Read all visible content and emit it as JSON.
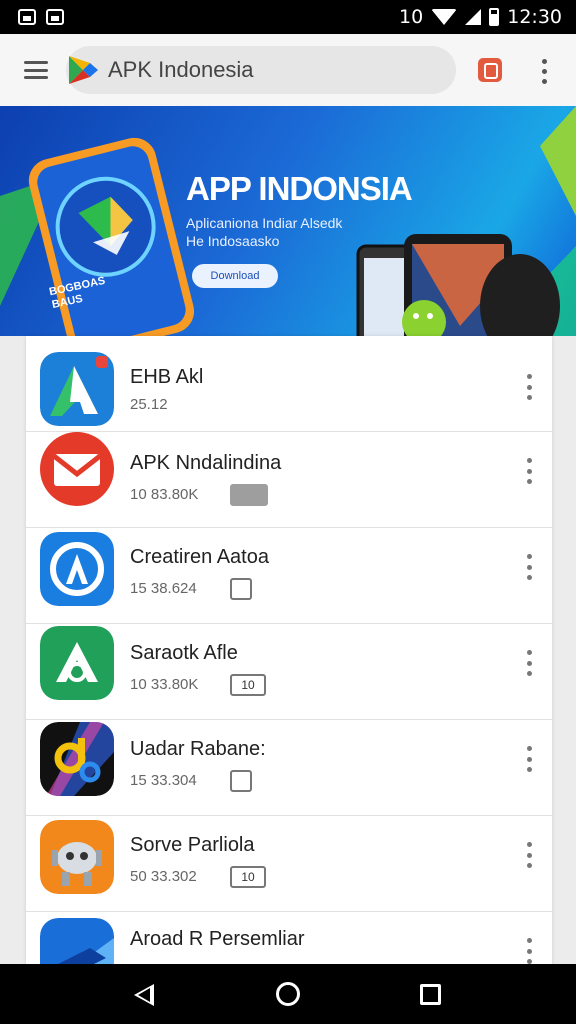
{
  "status_bar": {
    "indicators": "10",
    "time": "12:30"
  },
  "app_bar": {
    "search_text": "APK Indonesia"
  },
  "banner": {
    "title": "APP INDONSIA",
    "subtitle": "Aplicaniona Indiar Alsedk He Indosaasko",
    "button_label": "Download",
    "phone_text": "BOGBOAS BAUS"
  },
  "apps": [
    {
      "name": "EHB Akl",
      "meta": "25.12",
      "badge": "",
      "icon": "apk-installer-icon"
    },
    {
      "name": "APK Nndalindina",
      "meta": "10 83.80K",
      "badge": "",
      "icon": "mail-app-icon"
    },
    {
      "name": "Creatiren Aatoa",
      "meta": "15 38.624",
      "badge": "",
      "icon": "store-a-app-icon"
    },
    {
      "name": "Saraotk Afle",
      "meta": "10 33.80K",
      "badge": "10",
      "icon": "green-a-app-icon"
    },
    {
      "name": "Uadar Rabane:",
      "meta": "15 33.304",
      "badge": "",
      "icon": "color-d-app-icon"
    },
    {
      "name": "Sorve Parliola",
      "meta": "50 33.302",
      "badge": "10",
      "icon": "android-robot-app-icon"
    },
    {
      "name": "Aroad R Persemliar",
      "meta": "",
      "badge": "",
      "icon": "racing-car-app-icon"
    }
  ]
}
